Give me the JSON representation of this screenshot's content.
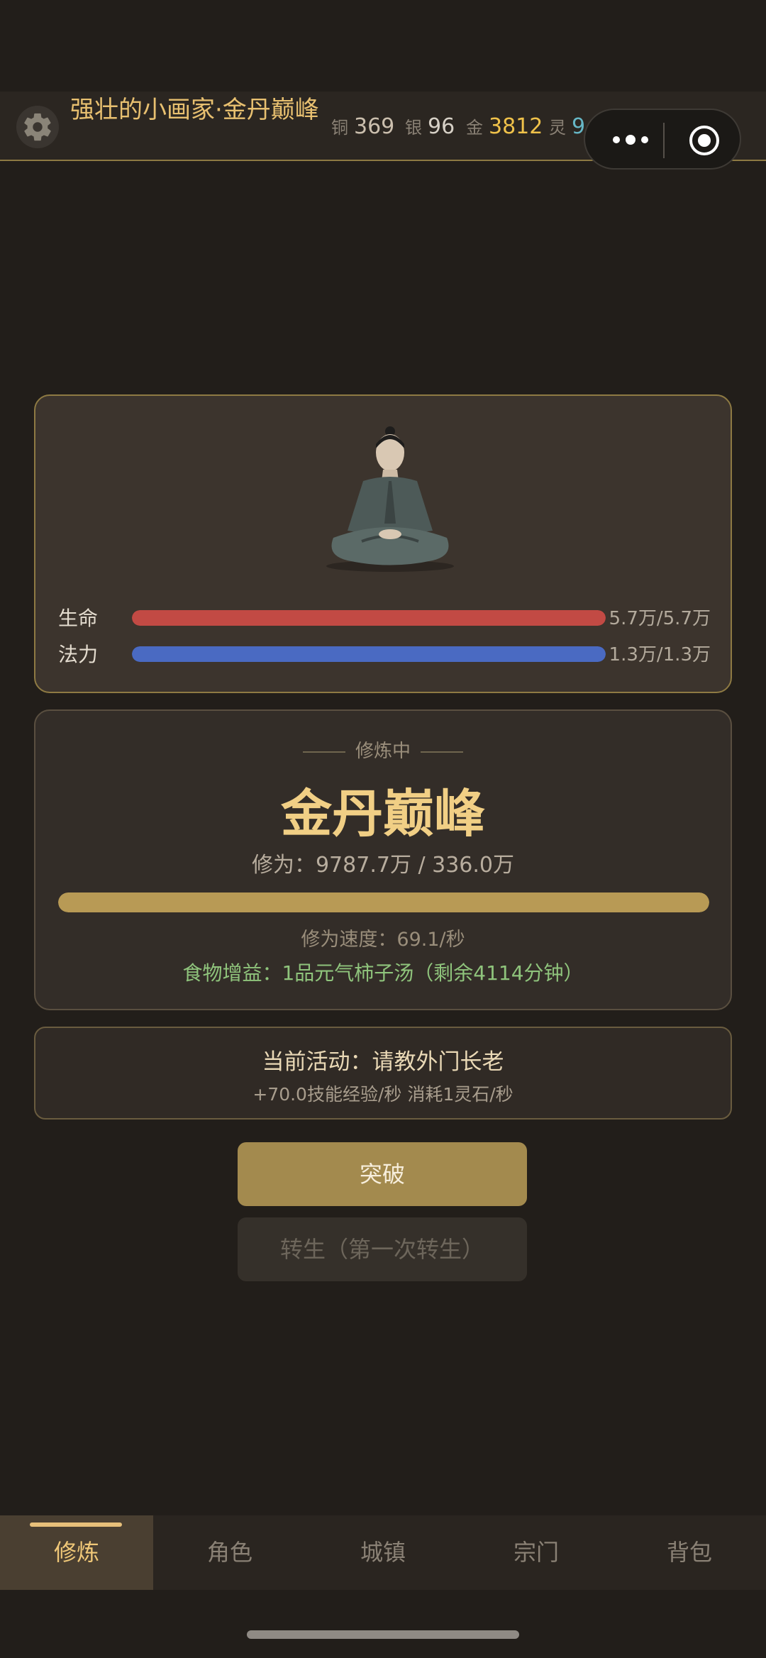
{
  "header": {
    "title": "强壮的小画家·金丹巅峰",
    "currencies": [
      {
        "label": "铜",
        "value": "369"
      },
      {
        "label": "银",
        "value": "96"
      },
      {
        "label": "金",
        "value": "3812"
      },
      {
        "label": "灵",
        "value": "9.6万"
      }
    ]
  },
  "character": {
    "stats": [
      {
        "name": "生命",
        "value": "5.7万/5.7万",
        "fill": 1.0,
        "color": "#c24a44"
      },
      {
        "name": "法力",
        "value": "1.3万/1.3万",
        "fill": 1.0,
        "color": "#4a6ac2"
      }
    ]
  },
  "cultivation": {
    "status": "修炼中",
    "realm": "金丹巅峰",
    "exp_text": "修为：9787.7万 / 336.0万",
    "exp_fill": 1.0,
    "speed": "修为速度：69.1/秒",
    "food": "食物增益：1品元气柿子汤（剩余4114分钟）"
  },
  "activity": {
    "title": "当前活动：请教外门长老",
    "detail": "+70.0技能经验/秒  消耗1灵石/秒"
  },
  "buttons": {
    "breakthrough": "突破",
    "rebirth": "转生（第一次转生）"
  },
  "nav": {
    "items": [
      "修炼",
      "角色",
      "城镇",
      "宗门",
      "背包"
    ],
    "active_index": 0
  },
  "colors": {
    "accent": "#e8c070",
    "gold": "#f0c24a",
    "spirit": "#66b7c6",
    "food": "#8fc47c",
    "primary_button": "#a38a4e"
  },
  "icons": {
    "settings": "gear-icon",
    "more": "more-dots-icon",
    "close": "target-circle-icon"
  }
}
